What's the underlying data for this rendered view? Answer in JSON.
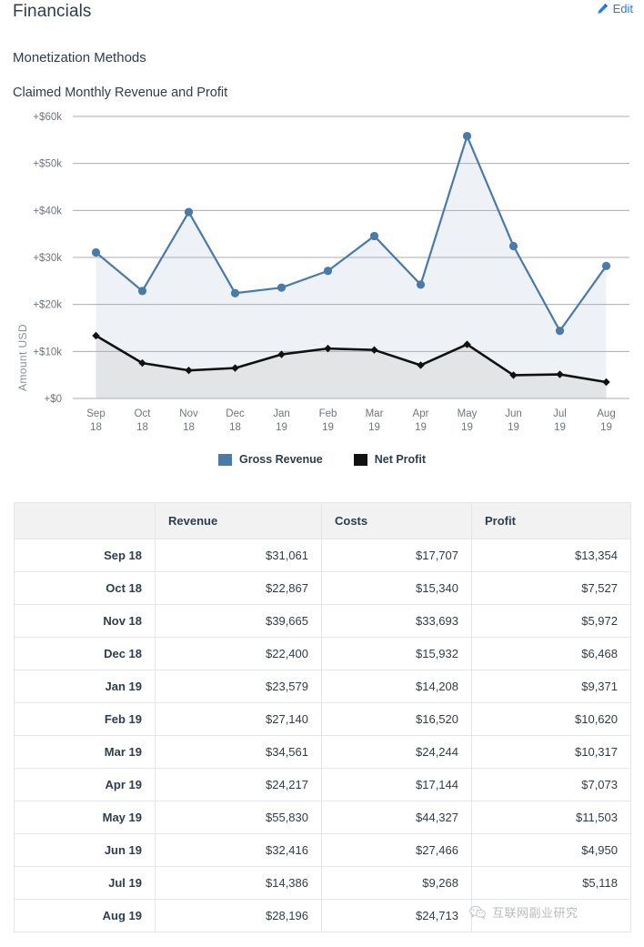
{
  "header": {
    "title": "Financials",
    "edit_label": "Edit",
    "edit_icon": "pencil-icon",
    "accent_color": "#1a7af8"
  },
  "sections": {
    "monetization_heading": "Monetization Methods",
    "chart_heading": "Claimed Monthly Revenue and Profit"
  },
  "chart_data": {
    "type": "line",
    "title": "Claimed Monthly Revenue and Profit",
    "xlabel": "",
    "ylabel": "Amount USD",
    "grid": true,
    "legend_position": "bottom",
    "ylim": [
      0,
      60000
    ],
    "ytick_labels": [
      "+$0",
      "+$10k",
      "+$20k",
      "+$30k",
      "+$40k",
      "+$50k",
      "+$60k"
    ],
    "ytick_values": [
      0,
      10000,
      20000,
      30000,
      40000,
      50000,
      60000
    ],
    "categories": [
      "Sep 18",
      "Oct 18",
      "Nov 18",
      "Dec 18",
      "Jan 19",
      "Feb 19",
      "Mar 19",
      "Apr 19",
      "May 19",
      "Jun 19",
      "Jul 19",
      "Aug 19"
    ],
    "xtick_lines": [
      [
        "Sep",
        "18"
      ],
      [
        "Oct",
        "18"
      ],
      [
        "Nov",
        "18"
      ],
      [
        "Dec",
        "18"
      ],
      [
        "Jan",
        "19"
      ],
      [
        "Feb",
        "19"
      ],
      [
        "Mar",
        "19"
      ],
      [
        "Apr",
        "19"
      ],
      [
        "May",
        "19"
      ],
      [
        "Jun",
        "19"
      ],
      [
        "Jul",
        "19"
      ],
      [
        "Aug",
        "19"
      ]
    ],
    "series": [
      {
        "name": "Gross Revenue",
        "color": "#4a7aa8",
        "marker": "circle",
        "values": [
          31061,
          22867,
          39665,
          22400,
          23579,
          27140,
          34561,
          24217,
          55830,
          32416,
          14386,
          28196
        ]
      },
      {
        "name": "Net Profit",
        "color": "#111111",
        "marker": "diamond",
        "values": [
          13354,
          7527,
          5972,
          6468,
          9371,
          10620,
          10317,
          7073,
          11503,
          4950,
          5118,
          3483
        ]
      }
    ]
  },
  "table": {
    "columns": [
      "",
      "Revenue",
      "Costs",
      "Profit"
    ],
    "rows": [
      {
        "label": "Sep 18",
        "revenue": "$31,061",
        "costs": "$17,707",
        "profit": "$13,354"
      },
      {
        "label": "Oct 18",
        "revenue": "$22,867",
        "costs": "$15,340",
        "profit": "$7,527"
      },
      {
        "label": "Nov 18",
        "revenue": "$39,665",
        "costs": "$33,693",
        "profit": "$5,972"
      },
      {
        "label": "Dec 18",
        "revenue": "$22,400",
        "costs": "$15,932",
        "profit": "$6,468"
      },
      {
        "label": "Jan 19",
        "revenue": "$23,579",
        "costs": "$14,208",
        "profit": "$9,371"
      },
      {
        "label": "Feb 19",
        "revenue": "$27,140",
        "costs": "$16,520",
        "profit": "$10,620"
      },
      {
        "label": "Mar 19",
        "revenue": "$34,561",
        "costs": "$24,244",
        "profit": "$10,317"
      },
      {
        "label": "Apr 19",
        "revenue": "$24,217",
        "costs": "$17,144",
        "profit": "$7,073"
      },
      {
        "label": "May 19",
        "revenue": "$55,830",
        "costs": "$44,327",
        "profit": "$11,503"
      },
      {
        "label": "Jun 19",
        "revenue": "$32,416",
        "costs": "$27,466",
        "profit": "$4,950"
      },
      {
        "label": "Jul 19",
        "revenue": "$14,386",
        "costs": "$9,268",
        "profit": "$5,118"
      },
      {
        "label": "Aug 19",
        "revenue": "$28,196",
        "costs": "$24,713",
        "profit": ""
      }
    ]
  },
  "watermark": {
    "text": "互联网副业研究",
    "icon": "wechat-icon"
  }
}
